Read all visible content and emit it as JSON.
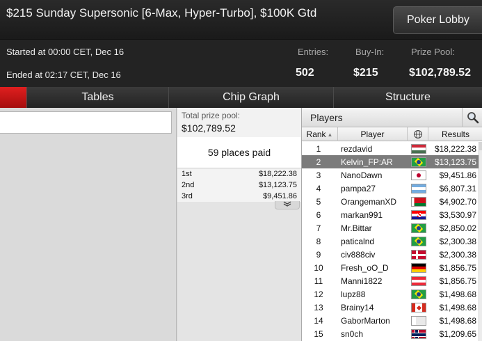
{
  "header": {
    "title": "$215 Sunday Supersonic [6-Max, Hyper-Turbo], $100K Gtd",
    "lobby_button": "Poker Lobby",
    "started": "Started at 00:00 CET, Dec 16",
    "ended": "Ended at 02:17 CET, Dec 16",
    "entries_label": "Entries:",
    "entries_value": "502",
    "buyin_label": "Buy-In:",
    "buyin_value": "$215",
    "prizepool_label": "Prize Pool:",
    "prizepool_value": "$102,789.52"
  },
  "tabs": [
    {
      "label": "Tables"
    },
    {
      "label": "Chip Graph"
    },
    {
      "label": "Structure"
    }
  ],
  "prize": {
    "label": "Total prize pool:",
    "total": "$102,789.52",
    "places_paid": "59 places paid",
    "payouts": [
      {
        "place": "1st",
        "amount": "$18,222.38"
      },
      {
        "place": "2nd",
        "amount": "$13,123.75"
      },
      {
        "place": "3rd",
        "amount": "$9,451.86"
      }
    ],
    "expand_icon": "chevron-down-icon"
  },
  "players": {
    "title": "Players",
    "columns": {
      "rank": "Rank",
      "player": "Player",
      "country": "globe-icon",
      "results": "Results"
    },
    "rows": [
      {
        "rank": "1",
        "name": "rezdavid",
        "flag": "hu",
        "result": "$18,222.38"
      },
      {
        "rank": "2",
        "name": "Kelvin_FP:AR",
        "flag": "br",
        "result": "$13,123.75",
        "selected": true
      },
      {
        "rank": "3",
        "name": "NanoDawn",
        "flag": "jp",
        "result": "$9,451.86"
      },
      {
        "rank": "4",
        "name": "pampa27",
        "flag": "ar",
        "result": "$6,807.31"
      },
      {
        "rank": "5",
        "name": "OrangemanXD",
        "flag": "by",
        "result": "$4,902.70"
      },
      {
        "rank": "6",
        "name": "markan991",
        "flag": "hr",
        "result": "$3,530.97"
      },
      {
        "rank": "7",
        "name": "Mr.Bittar",
        "flag": "br",
        "result": "$2,850.02"
      },
      {
        "rank": "8",
        "name": "paticalnd",
        "flag": "br",
        "result": "$2,300.38"
      },
      {
        "rank": "9",
        "name": "civ888civ",
        "flag": "dk",
        "result": "$2,300.38"
      },
      {
        "rank": "10",
        "name": "Fresh_oO_D",
        "flag": "de",
        "result": "$1,856.75"
      },
      {
        "rank": "11",
        "name": "Manni1822",
        "flag": "at",
        "result": "$1,856.75"
      },
      {
        "rank": "12",
        "name": "lupz88",
        "flag": "br",
        "result": "$1,498.68"
      },
      {
        "rank": "13",
        "name": "Brainy14",
        "flag": "ca",
        "result": "$1,498.68"
      },
      {
        "rank": "14",
        "name": "GaborMarton",
        "flag": "gr",
        "result": "$1,498.68"
      },
      {
        "rank": "15",
        "name": "sn0ch",
        "flag": "no",
        "result": "$1,209.65"
      }
    ]
  }
}
